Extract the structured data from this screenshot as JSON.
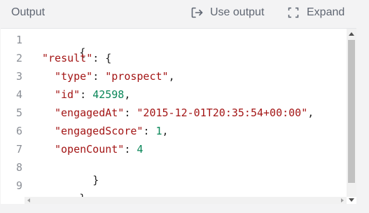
{
  "header": {
    "title": "Output",
    "use_output_label": "Use output",
    "use_output_icon": "sign-out-arrow-icon",
    "expand_label": "Expand",
    "expand_icon": "expand-corners-icon"
  },
  "editor": {
    "line_numbers": [
      "1",
      "2",
      "3",
      "4",
      "5",
      "6",
      "7",
      "8",
      "9"
    ],
    "tokens": {
      "l1": "{",
      "l2_key": "\"result\"",
      "l2_rest": ": {",
      "l3_key": "\"type\"",
      "l3_sep": ": ",
      "l3_val": "\"prospect\"",
      "l3_end": ",",
      "l4_key": "\"id\"",
      "l4_sep": ": ",
      "l4_val": "42598",
      "l4_end": ",",
      "l5_key": "\"engagedAt\"",
      "l5_sep": ": ",
      "l5_val": "\"2015-12-01T20:35:54+00:00\"",
      "l5_end": ",",
      "l6_key": "\"engagedScore\"",
      "l6_sep": ": ",
      "l6_val": "1",
      "l6_end": ",",
      "l7_key": "\"openCount\"",
      "l7_sep": ": ",
      "l7_val": "4",
      "l8": "}",
      "l9": "}"
    }
  },
  "colors": {
    "string": "#a31515",
    "number": "#098658",
    "line_number": "#8b8f96",
    "header_text": "#5f6672"
  }
}
